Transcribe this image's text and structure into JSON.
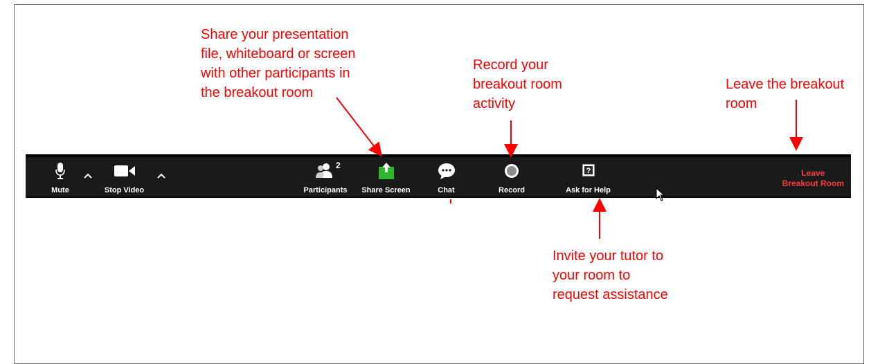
{
  "toolbar": {
    "mute_label": "Mute",
    "stop_video_label": "Stop Video",
    "participants_label": "Participants",
    "participants_count": "2",
    "share_screen_label": "Share Screen",
    "chat_label": "Chat",
    "record_label": "Record",
    "ask_help_label": "Ask for Help",
    "leave_line1": "Leave",
    "leave_line2": "Breakout Room",
    "colors": {
      "background": "#1a1a1a",
      "leave": "#ff3b3b",
      "share": "#2eb82e"
    },
    "icons": [
      "microphone-icon",
      "video-camera-icon",
      "participants-icon",
      "share-screen-icon",
      "chat-icon",
      "record-icon",
      "help-icon",
      "caret-up-icon"
    ]
  },
  "annotations": {
    "share": "Share your presentation\nfile, whiteboard or screen\nwith other participants in\nthe breakout room",
    "record": "Record your\nbreakout room\nactivity",
    "leave": "Leave the breakout\nroom",
    "help": "Invite your tutor to\nyour room to\nrequest assistance",
    "color": "#ff0000"
  }
}
